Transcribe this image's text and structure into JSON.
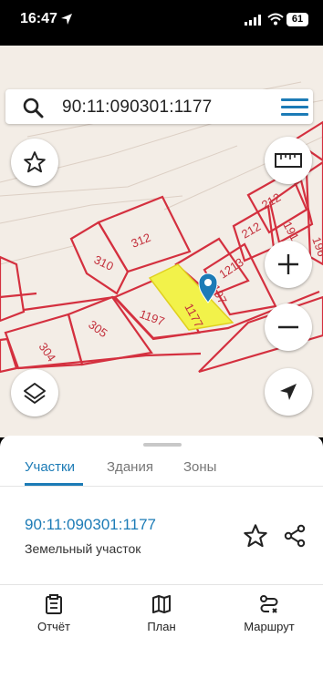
{
  "status_bar": {
    "time": "16:47",
    "battery": "61"
  },
  "search": {
    "value": "90:11:090301:1177"
  },
  "map": {
    "parcel_labels": [
      "312",
      "310",
      "1197",
      "1177",
      "1197",
      "1213",
      "304",
      "305",
      "212",
      "212",
      "191",
      "196"
    ]
  },
  "tabs": [
    "Участки",
    "Здания",
    "Зоны"
  ],
  "parcel": {
    "id": "90:11:090301:1177",
    "type": "Земельный участок"
  },
  "nav": {
    "report": "Отчёт",
    "plan": "План",
    "route": "Маршрут"
  },
  "colors": {
    "accent": "#1c7bb6",
    "parcel_border": "#d4303f",
    "selected_parcel": "#f2f24a",
    "map_bg": "#f3ede6"
  },
  "icons": [
    "search-icon",
    "menu-icon",
    "star-icon",
    "ruler-icon",
    "zoom-in-icon",
    "zoom-out-icon",
    "layers-icon",
    "navigation-arrow-icon",
    "location-pin-icon",
    "share-icon",
    "report-icon",
    "map-icon",
    "route-icon"
  ]
}
